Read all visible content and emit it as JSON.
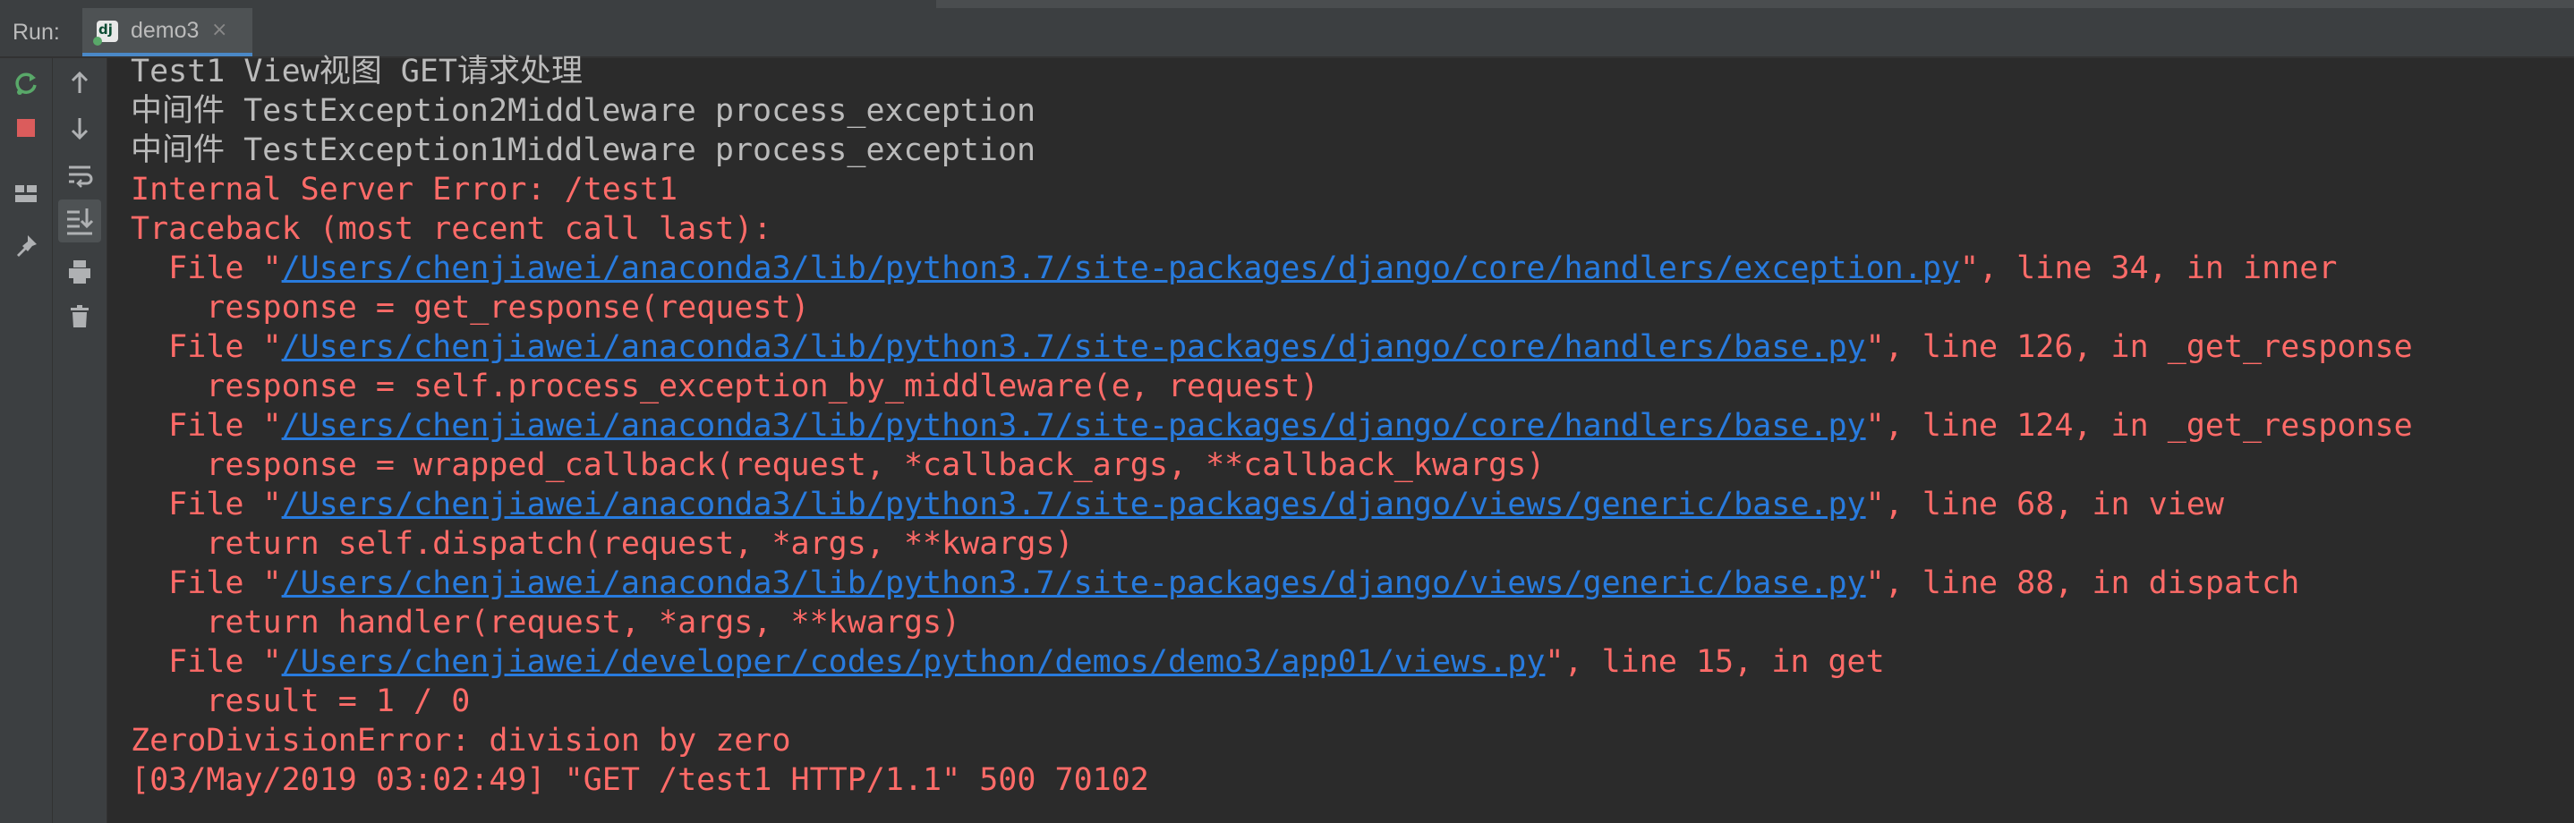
{
  "run_panel": {
    "label": "Run:",
    "tab": {
      "label": "demo3",
      "close": "×"
    }
  },
  "toolbar": {
    "left": [
      "rerun-icon",
      "stop-icon",
      "layout-icon",
      "pin-icon"
    ],
    "right": [
      "arrow-up-icon",
      "arrow-down-icon",
      "soft-wrap-icon",
      "scroll-to-end-icon",
      "print-icon",
      "trash-icon"
    ]
  },
  "colors": {
    "error": "#ff6b68",
    "link": "#287bde",
    "normal": "#bbbbbb",
    "background": "#2b2b2b"
  },
  "console": {
    "lines": [
      {
        "text": "Test1 View视图 GET请求处理"
      },
      {
        "text": "中间件 TestException2Middleware process_exception"
      },
      {
        "text": "中间件 TestException1Middleware process_exception"
      },
      {
        "text": "Internal Server Error: /test1"
      },
      {
        "text": "Traceback (most recent call last):"
      },
      {
        "prefix": "  File \"",
        "link": "/Users/chenjiawei/anaconda3/lib/python3.7/site-packages/django/core/handlers/exception.py",
        "suffix": "\", line 34, in inner"
      },
      {
        "text": "    response = get_response(request)"
      },
      {
        "prefix": "  File \"",
        "link": "/Users/chenjiawei/anaconda3/lib/python3.7/site-packages/django/core/handlers/base.py",
        "suffix": "\", line 126, in _get_response"
      },
      {
        "text": "    response = self.process_exception_by_middleware(e, request)"
      },
      {
        "prefix": "  File \"",
        "link": "/Users/chenjiawei/anaconda3/lib/python3.7/site-packages/django/core/handlers/base.py",
        "suffix": "\", line 124, in _get_response"
      },
      {
        "text": "    response = wrapped_callback(request, *callback_args, **callback_kwargs)"
      },
      {
        "prefix": "  File \"",
        "link": "/Users/chenjiawei/anaconda3/lib/python3.7/site-packages/django/views/generic/base.py",
        "suffix": "\", line 68, in view"
      },
      {
        "text": "    return self.dispatch(request, *args, **kwargs)"
      },
      {
        "prefix": "  File \"",
        "link": "/Users/chenjiawei/anaconda3/lib/python3.7/site-packages/django/views/generic/base.py",
        "suffix": "\", line 88, in dispatch"
      },
      {
        "text": "    return handler(request, *args, **kwargs)"
      },
      {
        "prefix": "  File \"",
        "link": "/Users/chenjiawei/developer/codes/python/demos/demo3/app01/views.py",
        "suffix": "\", line 15, in get"
      },
      {
        "text": "    result = 1 / 0"
      },
      {
        "text": "ZeroDivisionError: division by zero"
      },
      {
        "text": "[03/May/2019 03:02:49] \"GET /test1 HTTP/1.1\" 500 70102"
      }
    ]
  }
}
